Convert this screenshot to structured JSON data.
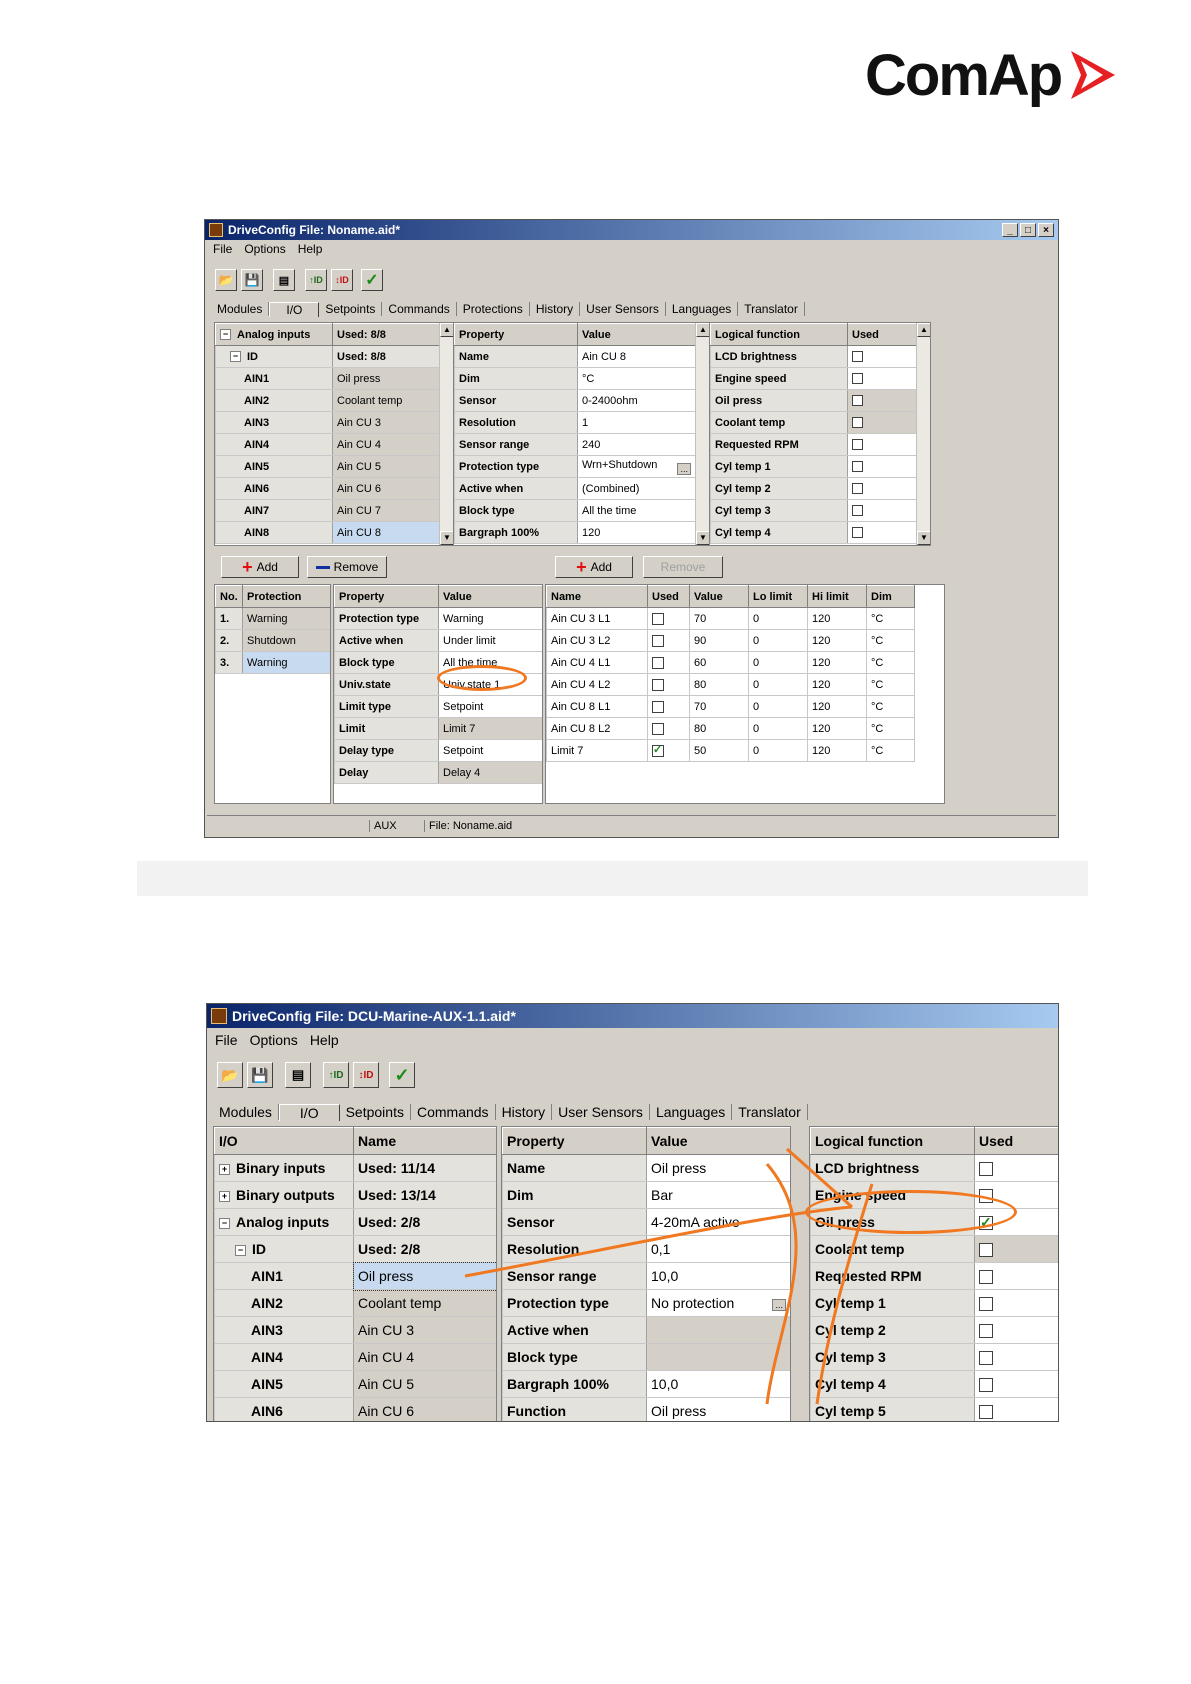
{
  "logo": {
    "text": "ComAp"
  },
  "colors": {
    "titlebar_start": "#0a246a",
    "titlebar_end": "#a6caf0",
    "window_bg": "#d4d0c8",
    "highlight_oval": "#f07820",
    "selection": "#c8daf0",
    "add_plus": "#e01010",
    "remove_minus": "#1030a0",
    "check": "#1a8a1a"
  },
  "screenshot1": {
    "title": "DriveConfig File: Noname.aid*",
    "menu": [
      "File",
      "Options",
      "Help"
    ],
    "toolbar_icons": [
      "open-folder-icon",
      "save-icon",
      "print-icon",
      "import-id-icon",
      "export-id-icon",
      "check-icon"
    ],
    "tabs": [
      "Modules",
      "I/O",
      "Setpoints",
      "Commands",
      "Protections",
      "History",
      "User Sensors",
      "Languages",
      "Translator"
    ],
    "active_tab": "I/O",
    "inputs_tree": {
      "headers": [
        "Analog inputs",
        "Used: 8/8"
      ],
      "id_row": [
        "ID",
        "Used: 8/8"
      ],
      "rows": [
        [
          "AIN1",
          "Oil press"
        ],
        [
          "AIN2",
          "Coolant temp"
        ],
        [
          "AIN3",
          "Ain CU 3"
        ],
        [
          "AIN4",
          "Ain CU 4"
        ],
        [
          "AIN5",
          "Ain CU 5"
        ],
        [
          "AIN6",
          "Ain CU 6"
        ],
        [
          "AIN7",
          "Ain CU 7"
        ],
        [
          "AIN8",
          "Ain CU 8"
        ]
      ]
    },
    "properties": {
      "headers": [
        "Property",
        "Value"
      ],
      "rows": [
        [
          "Name",
          "Ain CU 8"
        ],
        [
          "Dim",
          "°C"
        ],
        [
          "Sensor",
          "0-2400ohm"
        ],
        [
          "Resolution",
          "1"
        ],
        [
          "Sensor range",
          "240"
        ],
        [
          "Protection type",
          "Wrn+Shutdown"
        ],
        [
          "Active when",
          "(Combined)"
        ],
        [
          "Block type",
          "All the time"
        ],
        [
          "Bargraph 100%",
          "120"
        ]
      ]
    },
    "logical": {
      "headers": [
        "Logical function",
        "Used"
      ],
      "rows": [
        "LCD brightness",
        "Engine speed",
        "Oil press",
        "Coolant temp",
        "Requested RPM",
        "Cyl temp 1",
        "Cyl temp 2",
        "Cyl temp 3",
        "Cyl temp 4"
      ]
    },
    "buttons": {
      "add": "Add",
      "remove": "Remove",
      "add2": "Add",
      "remove2": "Remove"
    },
    "protections": {
      "headers": [
        "No.",
        "Protection"
      ],
      "rows": [
        [
          "1.",
          "Warning"
        ],
        [
          "2.",
          "Shutdown"
        ],
        [
          "3.",
          "Warning"
        ]
      ]
    },
    "prot_props": {
      "headers": [
        "Property",
        "Value"
      ],
      "rows": [
        [
          "Protection type",
          "Warning"
        ],
        [
          "Active when",
          "Under limit"
        ],
        [
          "Block type",
          "All the time"
        ],
        [
          "Univ.state",
          "Univ.state 1"
        ],
        [
          "Limit type",
          "Setpoint"
        ],
        [
          "Limit",
          "Limit 7"
        ],
        [
          "Delay type",
          "Setpoint"
        ],
        [
          "Delay",
          "Delay 4"
        ]
      ]
    },
    "setpoints": {
      "headers": [
        "Name",
        "Used",
        "Value",
        "Lo limit",
        "Hi limit",
        "Dim"
      ],
      "rows": [
        [
          "Ain CU 3 L1",
          false,
          "70",
          "0",
          "120",
          "°C"
        ],
        [
          "Ain CU 3 L2",
          false,
          "90",
          "0",
          "120",
          "°C"
        ],
        [
          "Ain CU 4 L1",
          false,
          "60",
          "0",
          "120",
          "°C"
        ],
        [
          "Ain CU 4 L2",
          false,
          "80",
          "0",
          "120",
          "°C"
        ],
        [
          "Ain CU 8 L1",
          false,
          "70",
          "0",
          "120",
          "°C"
        ],
        [
          "Ain CU 8 L2",
          false,
          "80",
          "0",
          "120",
          "°C"
        ],
        [
          "Limit 7",
          true,
          "50",
          "0",
          "120",
          "°C"
        ]
      ]
    },
    "status": {
      "module": "AUX",
      "file": "File: Noname.aid"
    }
  },
  "screenshot2": {
    "title": "DriveConfig File: DCU-Marine-AUX-1.1.aid*",
    "menu": [
      "File",
      "Options",
      "Help"
    ],
    "toolbar_icons": [
      "open-folder-icon",
      "save-icon",
      "print-icon",
      "import-id-icon",
      "export-id-icon",
      "check-icon"
    ],
    "tabs": [
      "Modules",
      "I/O",
      "Setpoints",
      "Commands",
      "History",
      "User Sensors",
      "Languages",
      "Translator"
    ],
    "active_tab": "I/O",
    "io_tree": {
      "headers": [
        "I/O",
        "Name"
      ],
      "groups": [
        [
          "Binary inputs",
          "Used: 11/14",
          "+"
        ],
        [
          "Binary outputs",
          "Used: 13/14",
          "+"
        ],
        [
          "Analog inputs",
          "Used: 2/8",
          "-"
        ]
      ],
      "id_row": [
        "ID",
        "Used: 2/8"
      ],
      "rows": [
        [
          "AIN1",
          "Oil press"
        ],
        [
          "AIN2",
          "Coolant temp"
        ],
        [
          "AIN3",
          "Ain CU 3"
        ],
        [
          "AIN4",
          "Ain CU 4"
        ],
        [
          "AIN5",
          "Ain CU 5"
        ],
        [
          "AIN6",
          "Ain CU 6"
        ]
      ]
    },
    "properties": {
      "headers": [
        "Property",
        "Value"
      ],
      "rows": [
        [
          "Name",
          "Oil press"
        ],
        [
          "Dim",
          "Bar"
        ],
        [
          "Sensor",
          "4-20mA active"
        ],
        [
          "Resolution",
          "0,1"
        ],
        [
          "Sensor range",
          "10,0"
        ],
        [
          "Protection type",
          "No protection"
        ],
        [
          "Active when",
          ""
        ],
        [
          "Block type",
          ""
        ],
        [
          "Bargraph 100%",
          "10,0"
        ],
        [
          "Function",
          "Oil press"
        ]
      ]
    },
    "logical": {
      "headers": [
        "Logical function",
        "Used"
      ],
      "rows": [
        [
          "LCD brightness",
          false
        ],
        [
          "Engine speed",
          false
        ],
        [
          "Oil press",
          true
        ],
        [
          "Coolant temp",
          false
        ],
        [
          "Requested RPM",
          false
        ],
        [
          "Cyl temp 1",
          false
        ],
        [
          "Cyl temp 2",
          false
        ],
        [
          "Cyl temp 3",
          false
        ],
        [
          "Cyl temp 4",
          false
        ],
        [
          "Cyl temp 5",
          false
        ]
      ]
    }
  }
}
